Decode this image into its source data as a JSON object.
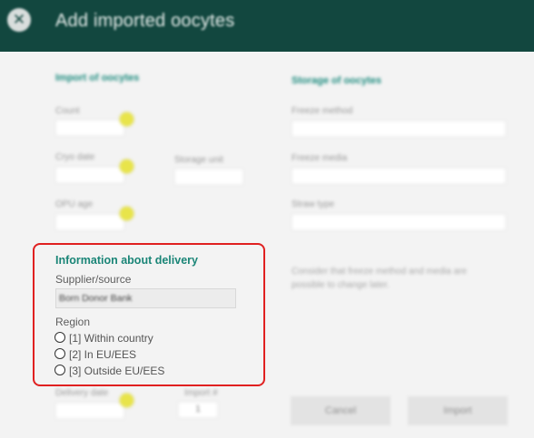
{
  "header": {
    "title": "Add imported oocytes",
    "close_icon": "close-icon"
  },
  "import_section": {
    "title": "Import of oocytes",
    "count_label": "Count",
    "cryo_date_label": "Cryo date",
    "storage_unit_label": "Storage unit",
    "ops_age_label": "OPU age"
  },
  "storage_section": {
    "title": "Storage of oocytes",
    "freeze_method_label": "Freeze method",
    "freeze_media_label": "Freeze media",
    "straw_type_label": "Straw type",
    "note": "Consider that freeze method and media are possible to change later."
  },
  "delivery": {
    "title": "Information about delivery",
    "supplier_label": "Supplier/source",
    "supplier_value": "Born Donor Bank",
    "region_label": "Region",
    "options": [
      "[1] Within country",
      "[2] In EU/EES",
      "[3] Outside EU/EES"
    ]
  },
  "footer": {
    "delivery_date_label": "Delivery date",
    "import_no_label": "Import #",
    "import_no_value": "1",
    "cancel_label": "Cancel",
    "import_label": "Import"
  },
  "colors": {
    "header": "#12473f",
    "accent": "#1a8577",
    "highlight_box": "#e02020",
    "indicator_dot": "#e8e44a"
  }
}
